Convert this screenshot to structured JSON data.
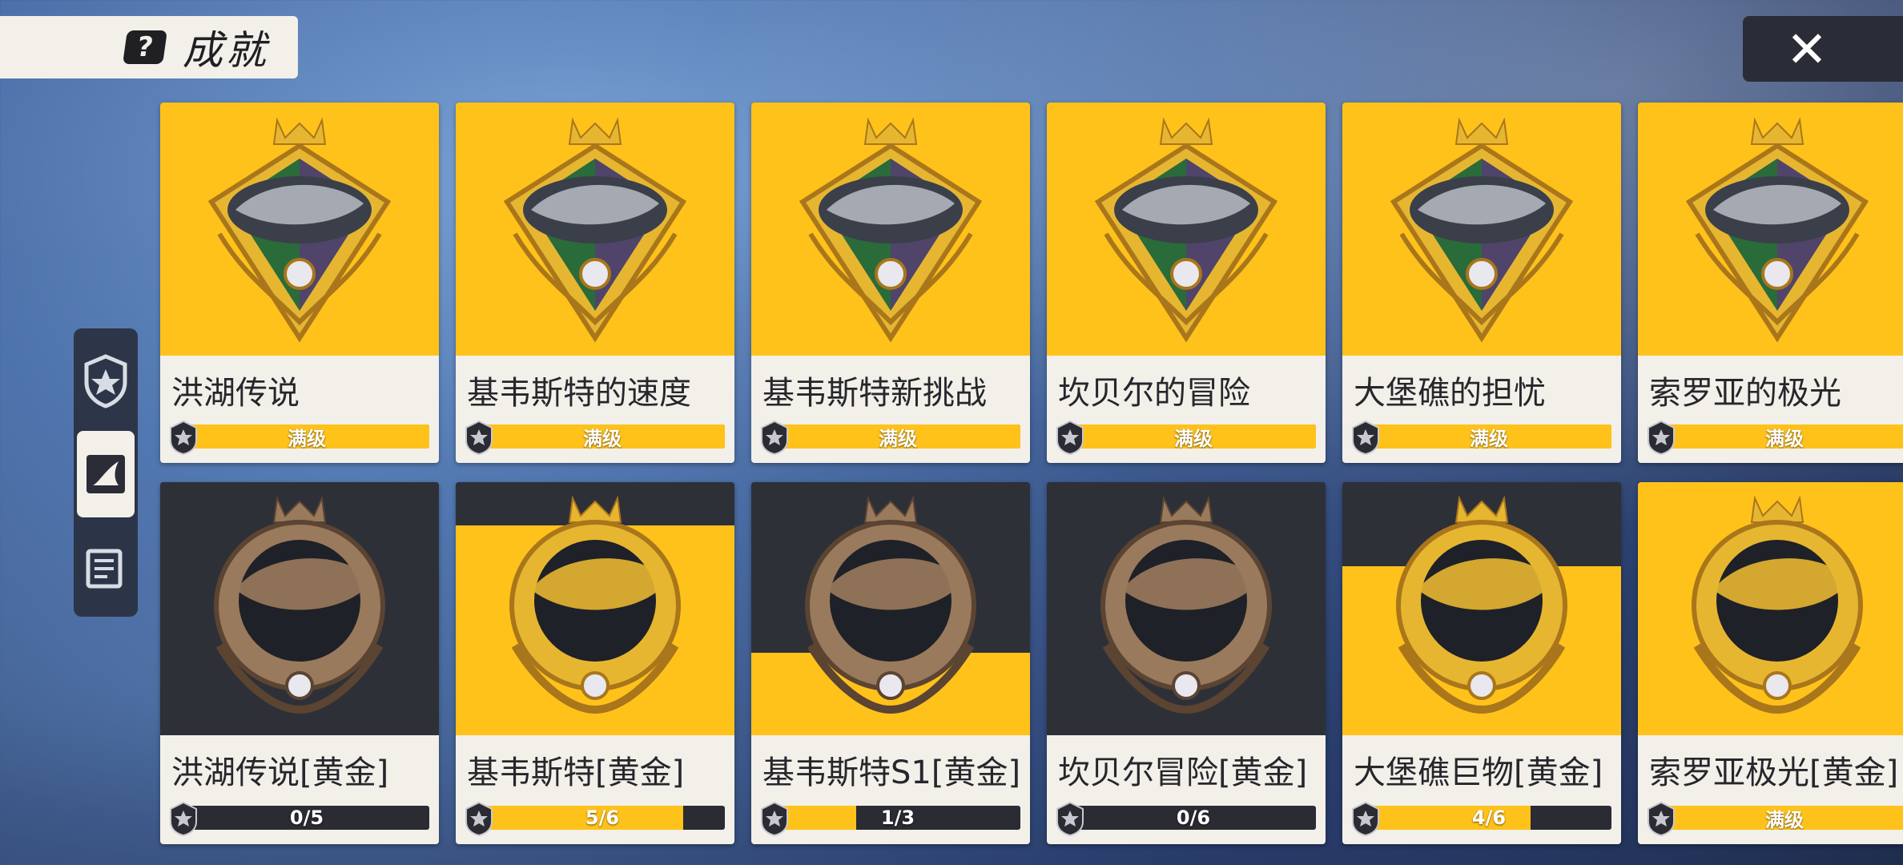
{
  "header": {
    "title": "成就",
    "help_icon": "?",
    "close_icon": "✕"
  },
  "colors": {
    "accent": "#ffc21a",
    "card_dark": "#2e3038",
    "card_light": "#f2f0e9"
  },
  "side_nav": [
    {
      "icon": "star-shield-icon",
      "active": false
    },
    {
      "icon": "shark-fin-icon",
      "active": true
    },
    {
      "icon": "notebook-icon",
      "active": false
    }
  ],
  "achievements": [
    {
      "name": "洪湖传说",
      "progress_text": "满级",
      "progress": 1.0,
      "tier": "diamond",
      "bg_fill": 1.0
    },
    {
      "name": "基韦斯特的速度",
      "progress_text": "满级",
      "progress": 1.0,
      "tier": "diamond",
      "bg_fill": 1.0
    },
    {
      "name": "基韦斯特新挑战",
      "progress_text": "满级",
      "progress": 1.0,
      "tier": "diamond",
      "bg_fill": 1.0
    },
    {
      "name": "坎贝尔的冒险",
      "progress_text": "满级",
      "progress": 1.0,
      "tier": "diamond",
      "bg_fill": 1.0
    },
    {
      "name": "大堡礁的担忧",
      "progress_text": "满级",
      "progress": 1.0,
      "tier": "diamond",
      "bg_fill": 1.0
    },
    {
      "name": "索罗亚的极光",
      "progress_text": "满级",
      "progress": 1.0,
      "tier": "diamond",
      "bg_fill": 1.0
    },
    {
      "name": "洪湖传说[黄金]",
      "progress_text": "0/5",
      "progress": 0.0,
      "tier": "bronze",
      "bg_fill": 0.0
    },
    {
      "name": "基韦斯特[黄金]",
      "progress_text": "5/6",
      "progress": 0.833,
      "tier": "gold",
      "bg_fill": 0.833
    },
    {
      "name": "基韦斯特S1[黄金]",
      "progress_text": "1/3",
      "progress": 0.333,
      "tier": "bronze",
      "bg_fill": 0.333
    },
    {
      "name": "坎贝尔冒险[黄金]",
      "progress_text": "0/6",
      "progress": 0.0,
      "tier": "bronze",
      "bg_fill": 0.0
    },
    {
      "name": "大堡礁巨物[黄金]",
      "progress_text": "4/6",
      "progress": 0.667,
      "tier": "gold",
      "bg_fill": 0.667
    },
    {
      "name": "索罗亚极光[黄金]",
      "progress_text": "满级",
      "progress": 1.0,
      "tier": "gold",
      "bg_fill": 1.0
    }
  ]
}
